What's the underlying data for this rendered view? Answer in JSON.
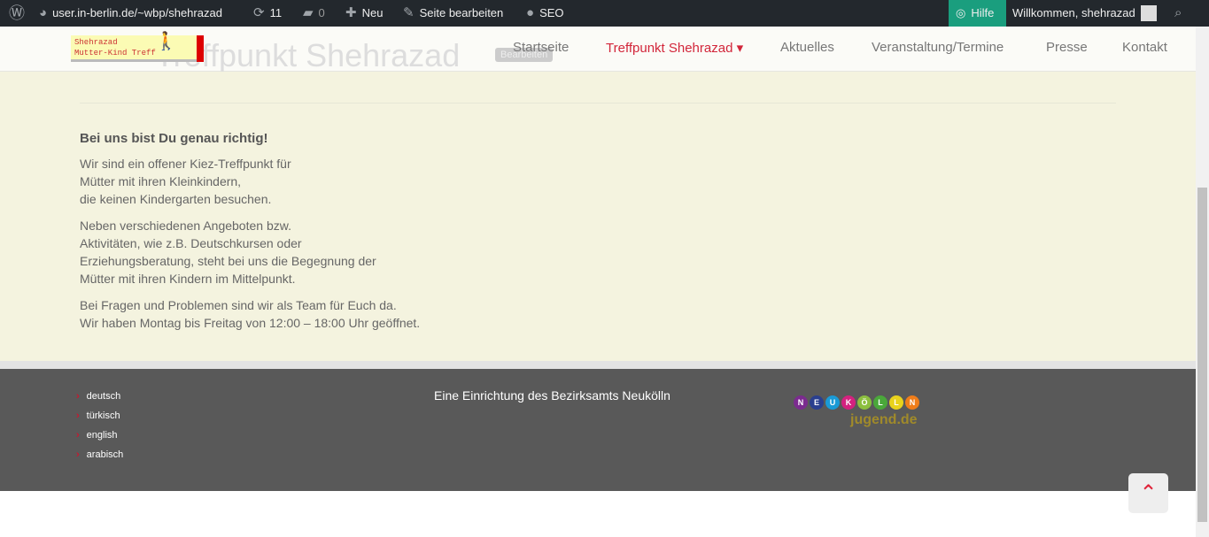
{
  "adminbar": {
    "site": "user.in-berlin.de/~wbp/shehrazad",
    "updates": "11",
    "comments": "0",
    "new": "Neu",
    "edit_page": "Seite bearbeiten",
    "seo": "SEO",
    "help": "Hilfe",
    "welcome": "Willkommen, shehrazad"
  },
  "header": {
    "logo_line1": "Shehrazad",
    "logo_line2": "Mutter-Kind Treff",
    "ghost_title": "Treffpunkt Shehrazad",
    "edit_label": "Bearbeiten",
    "nav": [
      {
        "label": "Startseite"
      },
      {
        "label": "Treffpunkt Shehrazad ▾",
        "active": true
      },
      {
        "label": "Aktuelles"
      },
      {
        "label": "Veranstaltung/Termine"
      },
      {
        "label": "Presse"
      },
      {
        "label": "Kontakt"
      }
    ],
    "accent": "#d2263a"
  },
  "content": {
    "heading": "Bei uns bist Du  genau richtig!",
    "p1": "Wir sind ein offener Kiez-Treffpunkt für\nMütter mit ihren Kleinkindern,\ndie keinen Kindergarten besuchen.",
    "p2": "Neben verschiedenen Angeboten bzw.\nAktivitäten, wie z.B. Deutschkursen oder\nErziehungsberatung, steht bei uns die Begegnung der\nMütter mit ihren Kindern im  Mittelpunkt.",
    "p3": "Bei Fragen und Problemen sind wir als Team für Euch da.\nWir haben Montag bis Freitag von 12:00 – 18:00 Uhr geöffnet."
  },
  "footer": {
    "languages": [
      "deutsch",
      "türkisch",
      "english",
      "arabisch"
    ],
    "institution": "Eine Einrichtung des Bezirksamts Neukölln",
    "logo_letters": "NEUKÖLLN",
    "logo_sub": "jugend.de"
  }
}
